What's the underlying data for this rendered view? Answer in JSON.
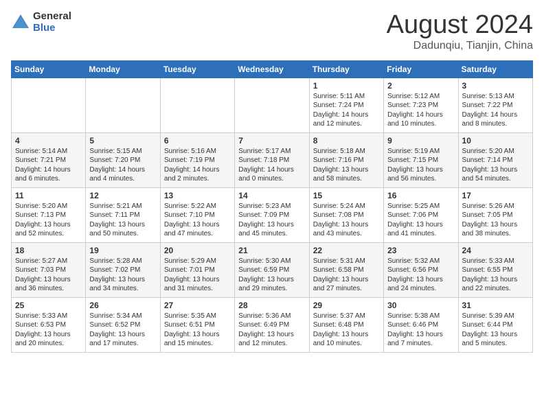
{
  "header": {
    "logo_general": "General",
    "logo_blue": "Blue",
    "month_year": "August 2024",
    "location": "Dadunqiu, Tianjin, China"
  },
  "days_of_week": [
    "Sunday",
    "Monday",
    "Tuesday",
    "Wednesday",
    "Thursday",
    "Friday",
    "Saturday"
  ],
  "weeks": [
    {
      "days": [
        {
          "number": "",
          "info": ""
        },
        {
          "number": "",
          "info": ""
        },
        {
          "number": "",
          "info": ""
        },
        {
          "number": "",
          "info": ""
        },
        {
          "number": "1",
          "info": "Sunrise: 5:11 AM\nSunset: 7:24 PM\nDaylight: 14 hours\nand 12 minutes."
        },
        {
          "number": "2",
          "info": "Sunrise: 5:12 AM\nSunset: 7:23 PM\nDaylight: 14 hours\nand 10 minutes."
        },
        {
          "number": "3",
          "info": "Sunrise: 5:13 AM\nSunset: 7:22 PM\nDaylight: 14 hours\nand 8 minutes."
        }
      ]
    },
    {
      "days": [
        {
          "number": "4",
          "info": "Sunrise: 5:14 AM\nSunset: 7:21 PM\nDaylight: 14 hours\nand 6 minutes."
        },
        {
          "number": "5",
          "info": "Sunrise: 5:15 AM\nSunset: 7:20 PM\nDaylight: 14 hours\nand 4 minutes."
        },
        {
          "number": "6",
          "info": "Sunrise: 5:16 AM\nSunset: 7:19 PM\nDaylight: 14 hours\nand 2 minutes."
        },
        {
          "number": "7",
          "info": "Sunrise: 5:17 AM\nSunset: 7:18 PM\nDaylight: 14 hours\nand 0 minutes."
        },
        {
          "number": "8",
          "info": "Sunrise: 5:18 AM\nSunset: 7:16 PM\nDaylight: 13 hours\nand 58 minutes."
        },
        {
          "number": "9",
          "info": "Sunrise: 5:19 AM\nSunset: 7:15 PM\nDaylight: 13 hours\nand 56 minutes."
        },
        {
          "number": "10",
          "info": "Sunrise: 5:20 AM\nSunset: 7:14 PM\nDaylight: 13 hours\nand 54 minutes."
        }
      ]
    },
    {
      "days": [
        {
          "number": "11",
          "info": "Sunrise: 5:20 AM\nSunset: 7:13 PM\nDaylight: 13 hours\nand 52 minutes."
        },
        {
          "number": "12",
          "info": "Sunrise: 5:21 AM\nSunset: 7:11 PM\nDaylight: 13 hours\nand 50 minutes."
        },
        {
          "number": "13",
          "info": "Sunrise: 5:22 AM\nSunset: 7:10 PM\nDaylight: 13 hours\nand 47 minutes."
        },
        {
          "number": "14",
          "info": "Sunrise: 5:23 AM\nSunset: 7:09 PM\nDaylight: 13 hours\nand 45 minutes."
        },
        {
          "number": "15",
          "info": "Sunrise: 5:24 AM\nSunset: 7:08 PM\nDaylight: 13 hours\nand 43 minutes."
        },
        {
          "number": "16",
          "info": "Sunrise: 5:25 AM\nSunset: 7:06 PM\nDaylight: 13 hours\nand 41 minutes."
        },
        {
          "number": "17",
          "info": "Sunrise: 5:26 AM\nSunset: 7:05 PM\nDaylight: 13 hours\nand 38 minutes."
        }
      ]
    },
    {
      "days": [
        {
          "number": "18",
          "info": "Sunrise: 5:27 AM\nSunset: 7:03 PM\nDaylight: 13 hours\nand 36 minutes."
        },
        {
          "number": "19",
          "info": "Sunrise: 5:28 AM\nSunset: 7:02 PM\nDaylight: 13 hours\nand 34 minutes."
        },
        {
          "number": "20",
          "info": "Sunrise: 5:29 AM\nSunset: 7:01 PM\nDaylight: 13 hours\nand 31 minutes."
        },
        {
          "number": "21",
          "info": "Sunrise: 5:30 AM\nSunset: 6:59 PM\nDaylight: 13 hours\nand 29 minutes."
        },
        {
          "number": "22",
          "info": "Sunrise: 5:31 AM\nSunset: 6:58 PM\nDaylight: 13 hours\nand 27 minutes."
        },
        {
          "number": "23",
          "info": "Sunrise: 5:32 AM\nSunset: 6:56 PM\nDaylight: 13 hours\nand 24 minutes."
        },
        {
          "number": "24",
          "info": "Sunrise: 5:33 AM\nSunset: 6:55 PM\nDaylight: 13 hours\nand 22 minutes."
        }
      ]
    },
    {
      "days": [
        {
          "number": "25",
          "info": "Sunrise: 5:33 AM\nSunset: 6:53 PM\nDaylight: 13 hours\nand 20 minutes."
        },
        {
          "number": "26",
          "info": "Sunrise: 5:34 AM\nSunset: 6:52 PM\nDaylight: 13 hours\nand 17 minutes."
        },
        {
          "number": "27",
          "info": "Sunrise: 5:35 AM\nSunset: 6:51 PM\nDaylight: 13 hours\nand 15 minutes."
        },
        {
          "number": "28",
          "info": "Sunrise: 5:36 AM\nSunset: 6:49 PM\nDaylight: 13 hours\nand 12 minutes."
        },
        {
          "number": "29",
          "info": "Sunrise: 5:37 AM\nSunset: 6:48 PM\nDaylight: 13 hours\nand 10 minutes."
        },
        {
          "number": "30",
          "info": "Sunrise: 5:38 AM\nSunset: 6:46 PM\nDaylight: 13 hours\nand 7 minutes."
        },
        {
          "number": "31",
          "info": "Sunrise: 5:39 AM\nSunset: 6:44 PM\nDaylight: 13 hours\nand 5 minutes."
        }
      ]
    }
  ]
}
